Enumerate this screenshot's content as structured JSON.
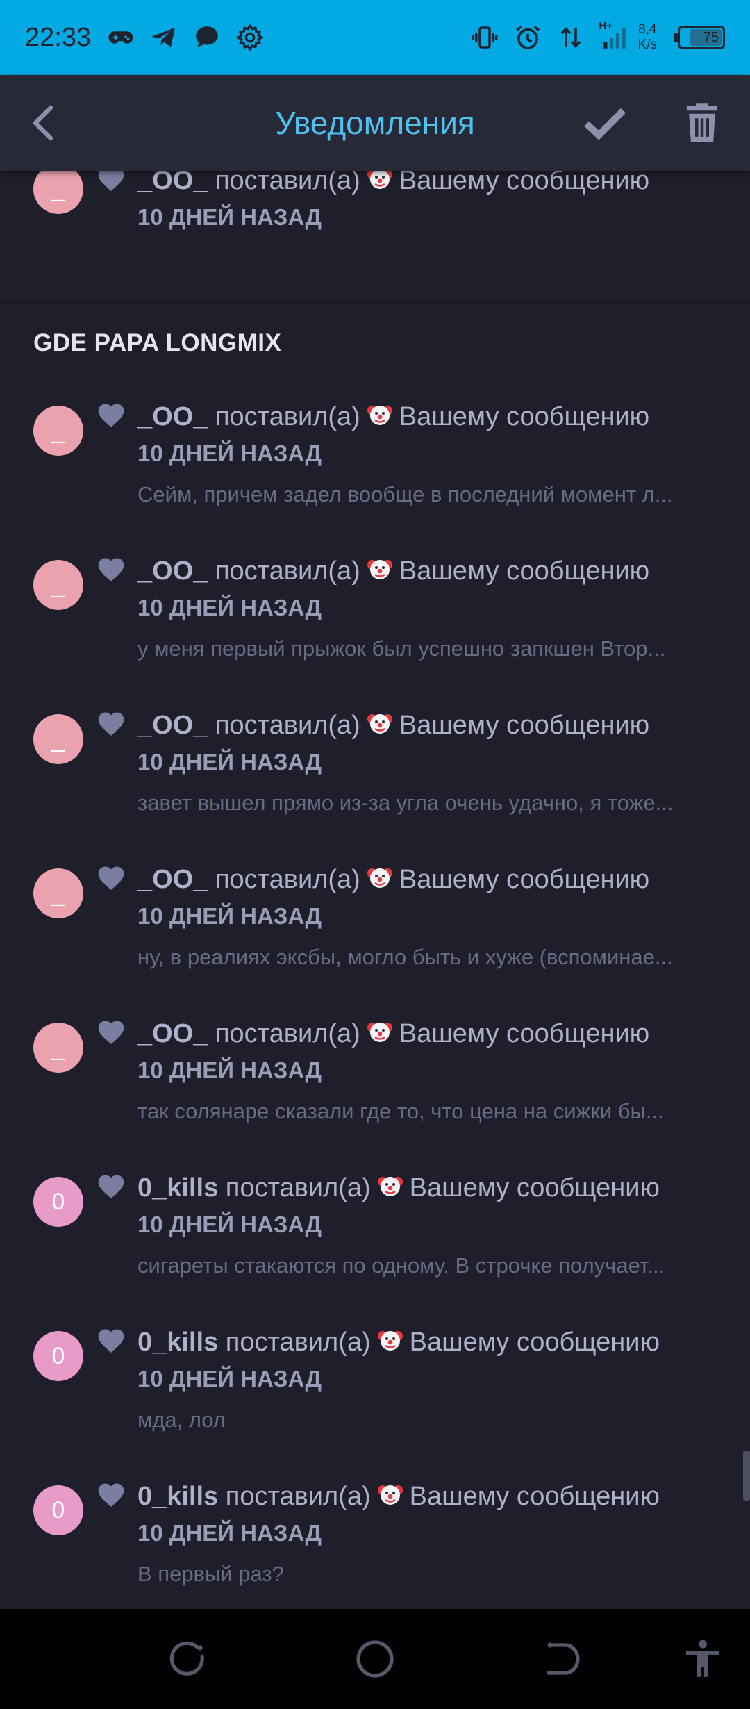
{
  "status": {
    "time": "22:33",
    "net_speed_value": "8,4",
    "net_speed_unit": "K/s",
    "network_type": "H+",
    "battery": "75",
    "battery_level": 75
  },
  "header": {
    "title": "Уведомления"
  },
  "partial_item": {
    "user": "_OO_",
    "action": "поставил(а)",
    "target": "Вашему сообщению",
    "time": "10 ДНЕЙ НАЗАД"
  },
  "section": {
    "title": "GDE PAPA LONGMIX"
  },
  "items": [
    {
      "avatar": "_",
      "avatar_color": "#eaa3ae",
      "user": "_OO_",
      "action": "поставил(а)",
      "target": "Вашему сообщению",
      "time": "10 ДНЕЙ НАЗАД",
      "preview": "Сейм, причем задел вообще в последний момент л..."
    },
    {
      "avatar": "_",
      "avatar_color": "#eaa3ae",
      "user": "_OO_",
      "action": "поставил(а)",
      "target": "Вашему сообщению",
      "time": "10 ДНЕЙ НАЗАД",
      "preview": "у меня первый прыжок был успешно запкшен Втор..."
    },
    {
      "avatar": "_",
      "avatar_color": "#eaa3ae",
      "user": "_OO_",
      "action": "поставил(а)",
      "target": "Вашему сообщению",
      "time": "10 ДНЕЙ НАЗАД",
      "preview": "завет вышел прямо из-за угла очень удачно, я тоже..."
    },
    {
      "avatar": "_",
      "avatar_color": "#eaa3ae",
      "user": "_OO_",
      "action": "поставил(а)",
      "target": "Вашему сообщению",
      "time": "10 ДНЕЙ НАЗАД",
      "preview": "ну, в реалиях эксбы, могло быть и хуже (вспоминае..."
    },
    {
      "avatar": "_",
      "avatar_color": "#eaa3ae",
      "user": "_OO_",
      "action": "поставил(а)",
      "target": "Вашему сообщению",
      "time": "10 ДНЕЙ НАЗАД",
      "preview": "так солянаре сказали где то, что цена на сижки бы..."
    },
    {
      "avatar": "0",
      "avatar_color": "#e89ac9",
      "user": "0_kills",
      "action": "поставил(а)",
      "target": "Вашему сообщению",
      "time": "10 ДНЕЙ НАЗАД",
      "preview": "сигареты стакаются по одному. В строчке получает..."
    },
    {
      "avatar": "0",
      "avatar_color": "#e89ac9",
      "user": "0_kills",
      "action": "поставил(а)",
      "target": "Вашему сообщению",
      "time": "10 ДНЕЙ НАЗАД",
      "preview": "мда, лол"
    },
    {
      "avatar": "0",
      "avatar_color": "#e89ac9",
      "user": "0_kills",
      "action": "поставил(а)",
      "target": "Вашему сообщению",
      "time": "10 ДНЕЙ НАЗАД",
      "preview": "В первый раз?"
    }
  ],
  "colors": {
    "status_bar": "#03a9e2",
    "app_bar": "#272936",
    "background": "#1e1f2b",
    "accent": "#4fc1f0",
    "icon": "#8d91ad"
  }
}
